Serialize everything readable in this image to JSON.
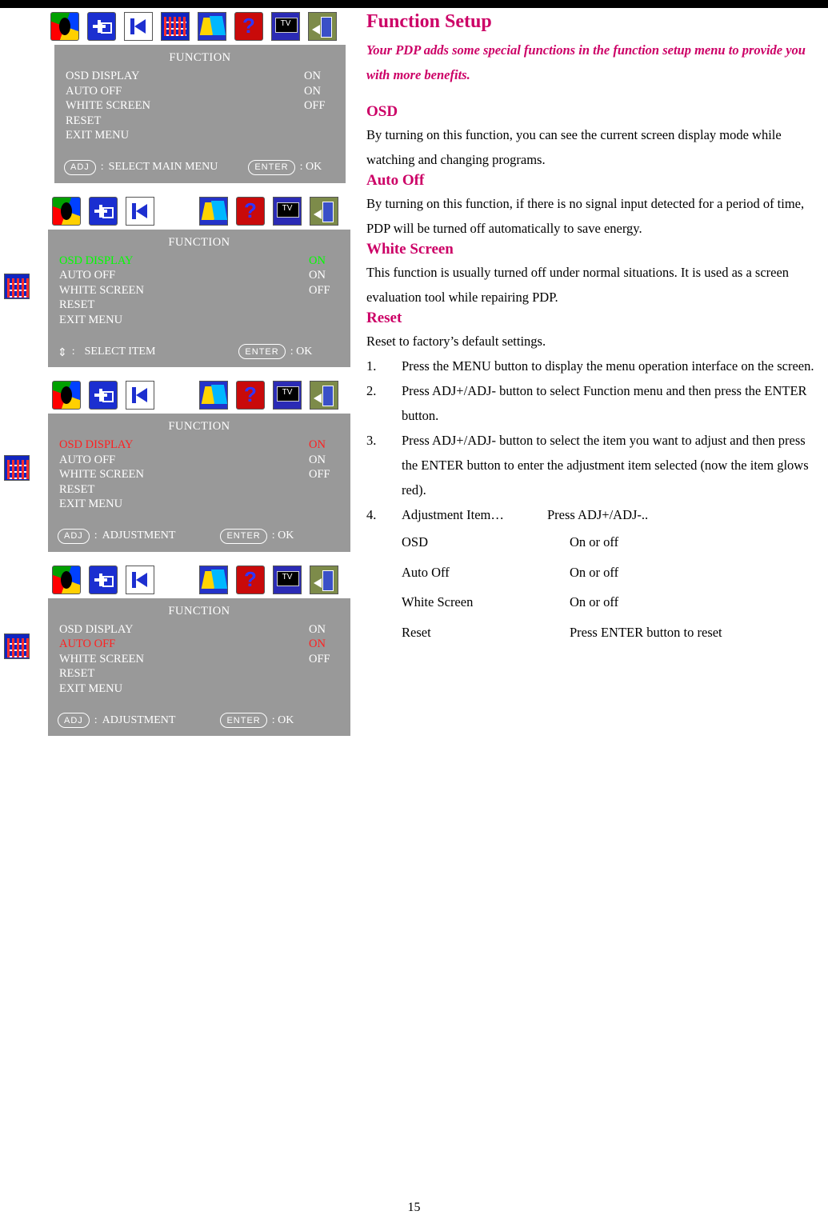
{
  "page": {
    "number": "15"
  },
  "icons": {
    "names": [
      "color-icon",
      "position-icon",
      "back-arrow-icon",
      "pattern-icon",
      "blue-shapes-icon",
      "question-icon",
      "tv-icon",
      "exit-icon"
    ]
  },
  "osd_panels": [
    {
      "title": "FUNCTION",
      "rows": [
        {
          "label": "OSD DISPLAY",
          "value": "ON",
          "state": "normal"
        },
        {
          "label": "AUTO OFF",
          "value": "ON",
          "state": "normal"
        },
        {
          "label": "WHITE SCREEN",
          "value": "OFF",
          "state": "normal"
        },
        {
          "label": "RESET",
          "value": "",
          "state": "normal"
        },
        {
          "label": "EXIT MENU",
          "value": "",
          "state": "normal"
        }
      ],
      "foot_left_pill": "ADJ",
      "foot_left_sep": ":",
      "foot_left_label": "SELECT MAIN MENU",
      "foot_right_pill": "ENTER",
      "foot_right_label": ": OK"
    },
    {
      "title": "FUNCTION",
      "rows": [
        {
          "label": "OSD DISPLAY",
          "value": "ON",
          "state": "green"
        },
        {
          "label": "AUTO OFF",
          "value": "ON",
          "state": "normal"
        },
        {
          "label": "WHITE SCREEN",
          "value": "OFF",
          "state": "normal"
        },
        {
          "label": "RESET",
          "value": "",
          "state": "normal"
        },
        {
          "label": "EXIT MENU",
          "value": "",
          "state": "normal"
        }
      ],
      "foot_left_pill": "",
      "foot_left_sep": ":",
      "foot_left_label": "SELECT ITEM",
      "foot_right_pill": "ENTER",
      "foot_right_label": ": OK"
    },
    {
      "title": "FUNCTION",
      "rows": [
        {
          "label": "OSD DISPLAY",
          "value": "ON",
          "state": "red"
        },
        {
          "label": "AUTO OFF",
          "value": "ON",
          "state": "normal"
        },
        {
          "label": "WHITE SCREEN",
          "value": "OFF",
          "state": "normal"
        },
        {
          "label": "RESET",
          "value": "",
          "state": "normal"
        },
        {
          "label": "EXIT MENU",
          "value": "",
          "state": "normal"
        }
      ],
      "foot_left_pill": "ADJ",
      "foot_left_sep": ":",
      "foot_left_label": "ADJUSTMENT",
      "foot_right_pill": "ENTER",
      "foot_right_label": ": OK"
    },
    {
      "title": "FUNCTION",
      "rows": [
        {
          "label": "OSD DISPLAY",
          "value": "ON",
          "state": "normal"
        },
        {
          "label": "AUTO OFF",
          "value": "ON",
          "state": "red"
        },
        {
          "label": "WHITE SCREEN",
          "value": "OFF",
          "state": "normal"
        },
        {
          "label": "RESET",
          "value": "",
          "state": "normal"
        },
        {
          "label": "EXIT MENU",
          "value": "",
          "state": "normal"
        }
      ],
      "foot_left_pill": "ADJ",
      "foot_left_sep": ":",
      "foot_left_label": "ADJUSTMENT",
      "foot_right_pill": "ENTER",
      "foot_right_label": ": OK"
    }
  ],
  "article": {
    "title": "Function Setup",
    "lead": "Your PDP adds some special functions in the function setup menu to provide you with more benefits.",
    "sections": [
      {
        "heading": "OSD",
        "body": "By turning on this function, you can see the current screen display mode while watching and changing programs."
      },
      {
        "heading": "Auto Off",
        "body": "By turning on this function, if there is no signal input detected for a period of time, PDP will be turned off automatically to save energy."
      },
      {
        "heading": "White Screen",
        "body": "This function is usually turned off under normal situations. It is used as a screen evaluation tool while repairing PDP."
      },
      {
        "heading": "Reset",
        "body": "Reset to factory’s default settings."
      }
    ],
    "steps": [
      {
        "num": "1.",
        "text": "Press the MENU button to display the menu operation interface on the screen."
      },
      {
        "num": "2.",
        "text": "Press ADJ+/ADJ- button to select Function menu and then press the ENTER button."
      },
      {
        "num": "3.",
        "text": "Press ADJ+/ADJ- button to select the item you want to adjust and then press the ENTER button to enter the adjustment item selected (now the item glows red)."
      },
      {
        "num": "4.",
        "text": "Adjustment Item…"
      }
    ],
    "step4_right": "Press ADJ+/ADJ-..",
    "adjustment_table": [
      {
        "item": "OSD",
        "action": "On or off"
      },
      {
        "item": "Auto Off",
        "action": "On or off"
      },
      {
        "item": "White Screen",
        "action": "On or off"
      },
      {
        "item": "Reset",
        "action": "Press ENTER button to reset"
      }
    ]
  }
}
